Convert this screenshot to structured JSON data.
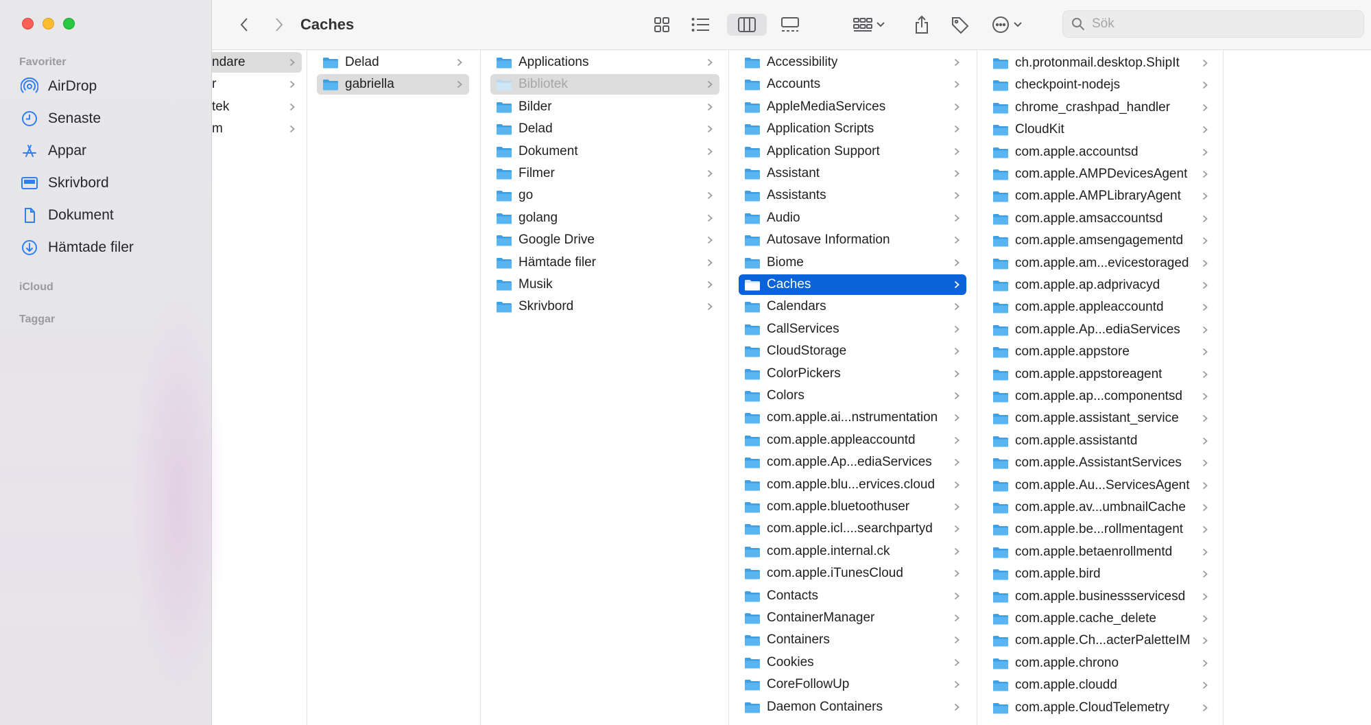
{
  "window": {
    "title": "Caches"
  },
  "toolbar": {
    "search_placeholder": "Sök"
  },
  "sidebar": {
    "favorites_header": "Favoriter",
    "favorites": [
      {
        "label": "AirDrop",
        "icon": "airdrop-icon"
      },
      {
        "label": "Senaste",
        "icon": "clock-icon"
      },
      {
        "label": "Appar",
        "icon": "apps-icon"
      },
      {
        "label": "Skrivbord",
        "icon": "desktop-icon"
      },
      {
        "label": "Dokument",
        "icon": "document-icon"
      },
      {
        "label": "Hämtade filer",
        "icon": "download-icon"
      }
    ],
    "icloud_header": "iCloud",
    "tags_header": "Taggar"
  },
  "columns": [
    {
      "items": [
        "ndare",
        "r",
        "tek",
        "m"
      ],
      "selected": 0
    },
    {
      "items": [
        "Delad",
        "gabriella"
      ],
      "selected": 1
    },
    {
      "items": [
        "Applications",
        "Bibliotek",
        "Bilder",
        "Delad",
        "Dokument",
        "Filmer",
        "go",
        "golang",
        "Google Drive",
        "Hämtade filer",
        "Musik",
        "Skrivbord"
      ],
      "selected": 1
    },
    {
      "items": [
        "Accessibility",
        "Accounts",
        "AppleMediaServices",
        "Application Scripts",
        "Application Support",
        "Assistant",
        "Assistants",
        "Audio",
        "Autosave Information",
        "Biome",
        "Caches",
        "Calendars",
        "CallServices",
        "CloudStorage",
        "ColorPickers",
        "Colors",
        "com.apple.ai...nstrumentation",
        "com.apple.appleaccountd",
        "com.apple.Ap...ediaServices",
        "com.apple.blu...ervices.cloud",
        "com.apple.bluetoothuser",
        "com.apple.icl....searchpartyd",
        "com.apple.internal.ck",
        "com.apple.iTunesCloud",
        "Contacts",
        "ContainerManager",
        "Containers",
        "Cookies",
        "CoreFollowUp",
        "Daemon Containers"
      ],
      "selected": 10
    },
    {
      "items": [
        "ch.protonmail.desktop.ShipIt",
        "checkpoint-nodejs",
        "chrome_crashpad_handler",
        "CloudKit",
        "com.apple.accountsd",
        "com.apple.AMPDevicesAgent",
        "com.apple.AMPLibraryAgent",
        "com.apple.amsaccountsd",
        "com.apple.amsengagementd",
        "com.apple.am...evicestoraged",
        "com.apple.ap.adprivacyd",
        "com.apple.appleaccountd",
        "com.apple.Ap...ediaServices",
        "com.apple.appstore",
        "com.apple.appstoreagent",
        "com.apple.ap...componentsd",
        "com.apple.assistant_service",
        "com.apple.assistantd",
        "com.apple.AssistantServices",
        "com.apple.Au...ServicesAgent",
        "com.apple.av...umbnailCache",
        "com.apple.be...rollmentagent",
        "com.apple.betaenrollmentd",
        "com.apple.bird",
        "com.apple.businessservicesd",
        "com.apple.cache_delete",
        "com.apple.Ch...acterPaletteIM",
        "com.apple.chrono",
        "com.apple.cloudd",
        "com.apple.CloudTelemetry"
      ],
      "selected": -1,
      "partial_top": "ch.protonmail.desktop"
    }
  ],
  "colors": {
    "accent": "#0a63d8",
    "folder": "#5ab4ef",
    "folder_dark": "#3f9fe3"
  }
}
